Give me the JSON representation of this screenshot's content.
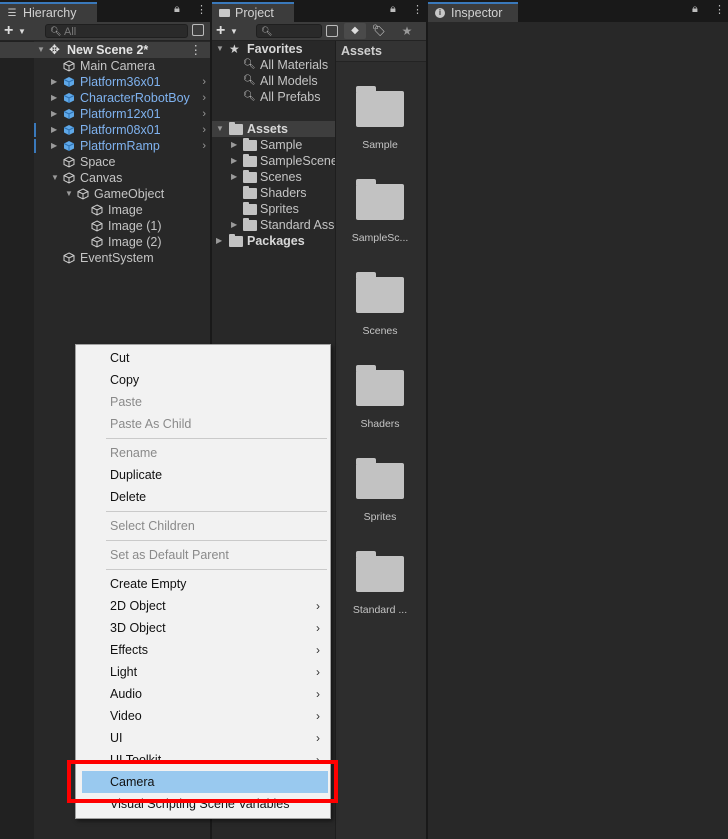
{
  "hierarchy": {
    "tab_label": "Hierarchy",
    "search_placeholder": "All",
    "scene_name": "New Scene 2*",
    "items": [
      {
        "label": "Main Camera",
        "prefab": false
      },
      {
        "label": "Platform36x01",
        "prefab": true
      },
      {
        "label": "CharacterRobotBoy",
        "prefab": true
      },
      {
        "label": "Platform12x01",
        "prefab": true
      },
      {
        "label": "Platform08x01",
        "prefab": true
      },
      {
        "label": "PlatformRamp",
        "prefab": true
      },
      {
        "label": "Space",
        "prefab": false
      },
      {
        "label": "Canvas",
        "prefab": false
      },
      {
        "label": "GameObject",
        "prefab": false
      },
      {
        "label": "Image",
        "prefab": false
      },
      {
        "label": "Image (1)",
        "prefab": false
      },
      {
        "label": "Image (2)",
        "prefab": false
      },
      {
        "label": "EventSystem",
        "prefab": false
      }
    ]
  },
  "project": {
    "tab_label": "Project",
    "favorites_label": "Favorites",
    "favorites": [
      "All Materials",
      "All Models",
      "All Prefabs"
    ],
    "assets_label": "Assets",
    "asset_folders": [
      "Sample",
      "SampleScene",
      "Scenes",
      "Shaders",
      "Sprites",
      "Standard Assets"
    ],
    "packages_label": "Packages",
    "grid_header": "Assets",
    "grid_items": [
      "Sample",
      "SampleSc...",
      "Scenes",
      "Shaders",
      "Sprites",
      "Standard ..."
    ]
  },
  "inspector": {
    "tab_label": "Inspector"
  },
  "context_menu": {
    "items": [
      {
        "label": "Cut"
      },
      {
        "label": "Copy"
      },
      {
        "label": "Paste"
      },
      {
        "label": "Paste As Child"
      },
      {
        "label": "Rename"
      },
      {
        "label": "Duplicate"
      },
      {
        "label": "Delete"
      },
      {
        "label": "Select Children"
      },
      {
        "label": "Set as Default Parent"
      },
      {
        "label": "Create Empty"
      },
      {
        "label": "2D Object"
      },
      {
        "label": "3D Object"
      },
      {
        "label": "Effects"
      },
      {
        "label": "Light"
      },
      {
        "label": "Audio"
      },
      {
        "label": "Video"
      },
      {
        "label": "UI"
      },
      {
        "label": "UI Toolkit"
      },
      {
        "label": "Camera"
      },
      {
        "label": "Visual Scripting Scene Variables"
      }
    ]
  },
  "colors": {
    "highlight": "#99c9ef",
    "annotation_box": "#ff0000",
    "prefab_text": "#7fb2ef"
  }
}
